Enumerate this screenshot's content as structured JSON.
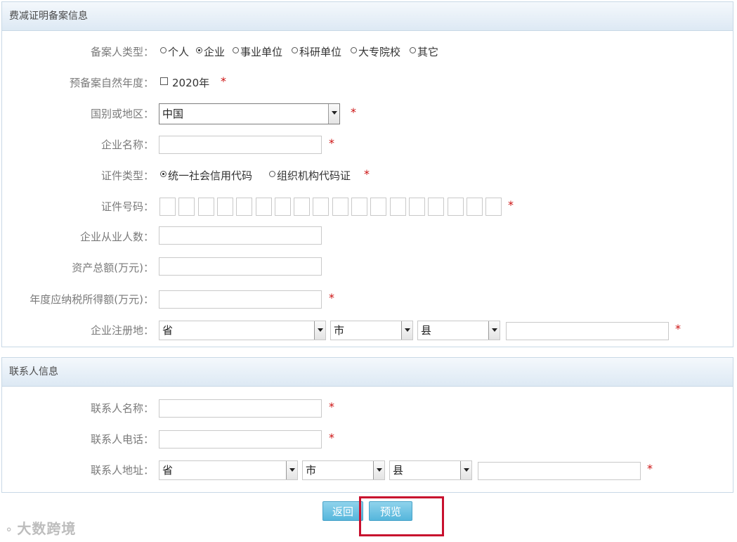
{
  "section1": {
    "title": "费减证明备案信息",
    "registrant_type": {
      "label": "备案人类型：",
      "options": [
        "个人",
        "企业",
        "事业单位",
        "科研单位",
        "大专院校",
        "其它"
      ],
      "selected": "企业"
    },
    "pre_record_year": {
      "label": "预备案自然年度：",
      "option": "2020年",
      "required": "*"
    },
    "country": {
      "label": "国别或地区：",
      "value": "中国",
      "required": "*"
    },
    "company_name": {
      "label": "企业名称：",
      "value": "",
      "required": "*"
    },
    "cert_type": {
      "label": "证件类型：",
      "options": [
        "统一社会信用代码",
        "组织机构代码证"
      ],
      "selected": "统一社会信用代码",
      "required": "*"
    },
    "cert_number": {
      "label": "证件号码：",
      "required": "*"
    },
    "employees": {
      "label": "企业从业人数：",
      "value": ""
    },
    "total_assets": {
      "label": "资产总额(万元)：",
      "value": ""
    },
    "annual_tax": {
      "label": "年度应纳税所得额(万元)：",
      "value": "",
      "required": "*"
    },
    "registered_address": {
      "label": "企业注册地：",
      "province": "省",
      "city": "市",
      "county": "县",
      "detail": "",
      "required": "*"
    }
  },
  "section2": {
    "title": "联系人信息",
    "contact_name": {
      "label": "联系人名称：",
      "value": "",
      "required": "*"
    },
    "contact_phone": {
      "label": "联系人电话：",
      "value": "",
      "required": "*"
    },
    "contact_address": {
      "label": "联系人地址：",
      "province": "省",
      "city": "市",
      "county": "县",
      "detail": "",
      "required": "*"
    }
  },
  "buttons": {
    "back": "返回",
    "preview": "预览"
  },
  "watermark": "大数跨境",
  "colors": {
    "required": "#cc1111",
    "button": "#55b6dc",
    "highlight": "#c8102e"
  }
}
